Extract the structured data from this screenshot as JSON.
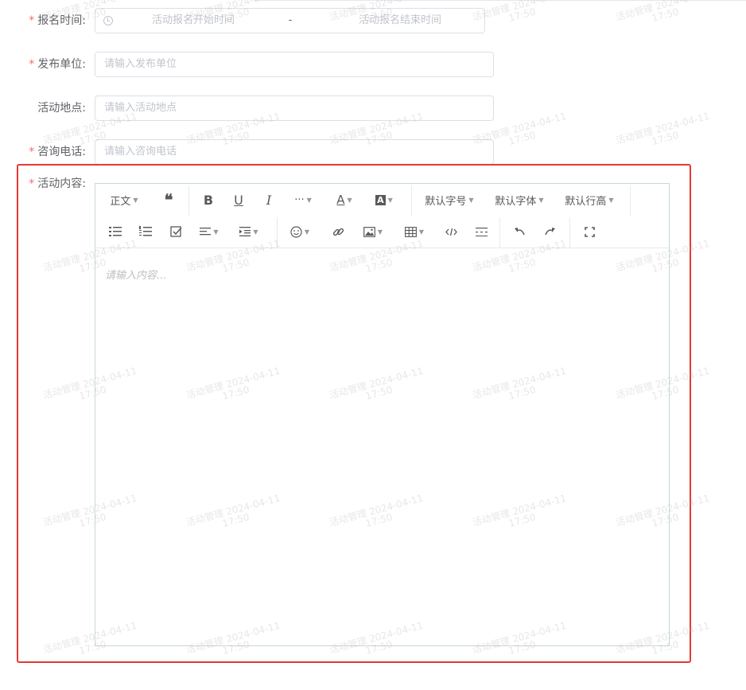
{
  "form": {
    "signup_time": {
      "label": "报名时间:",
      "start_placeholder": "活动报名开始时间",
      "separator": "-",
      "end_placeholder": "活动报名结束时间"
    },
    "publisher": {
      "label": "发布单位:",
      "placeholder": "请输入发布单位"
    },
    "location": {
      "label": "活动地点:",
      "placeholder": "请输入活动地点"
    },
    "phone": {
      "label": "咨询电话:",
      "placeholder": "请输入咨询电话"
    },
    "content": {
      "label": "活动内容:"
    },
    "required_mark": "*"
  },
  "editor": {
    "toolbar": {
      "paragraph_style": "正文",
      "font_size": "默认字号",
      "font_family": "默认字体",
      "line_height": "默认行高",
      "more": "···"
    },
    "placeholder": "请输入内容..."
  },
  "watermark": {
    "line1": "活动管理 2024-04-11",
    "line2": "17:50"
  },
  "colors": {
    "required": "#f56c6c",
    "highlight": "#e53935",
    "border": "#dcdfe6"
  }
}
